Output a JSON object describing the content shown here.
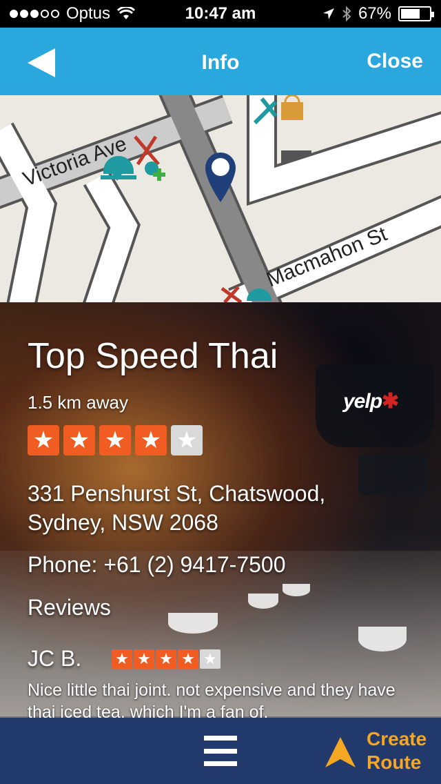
{
  "status_bar": {
    "carrier": "Optus",
    "time": "10:47 am",
    "battery": "67%",
    "battery_level": 0.67
  },
  "nav": {
    "title": "Info",
    "close_label": "Close"
  },
  "map": {
    "streets": [
      "Victoria Ave",
      "Macmahon St"
    ]
  },
  "restaurant": {
    "name": "Top Speed Thai",
    "distance": "1.5 km away",
    "rating": 4,
    "rating_max": 5,
    "address_line1": "331 Penshurst St, Chatswood,",
    "address_line2": "Sydney, NSW 2068",
    "phone": "Phone: +61 (2) 9417-7500",
    "provider": "yelp"
  },
  "reviews": {
    "heading": "Reviews",
    "items": [
      {
        "author": "JC B.",
        "rating": 4,
        "text": "Nice little thai joint. not expensive and they have thai iced tea, which I'm a fan of."
      }
    ]
  },
  "bottom_bar": {
    "route_label_line1": "Create",
    "route_label_line2": "Route"
  },
  "colors": {
    "nav_bg": "#2aa7dc",
    "bottom_bg": "#213a6b",
    "star_on": "#f15c22",
    "star_off": "#d9d9d9",
    "route_accent": "#f5a623",
    "map_pin": "#1f3f7a"
  }
}
